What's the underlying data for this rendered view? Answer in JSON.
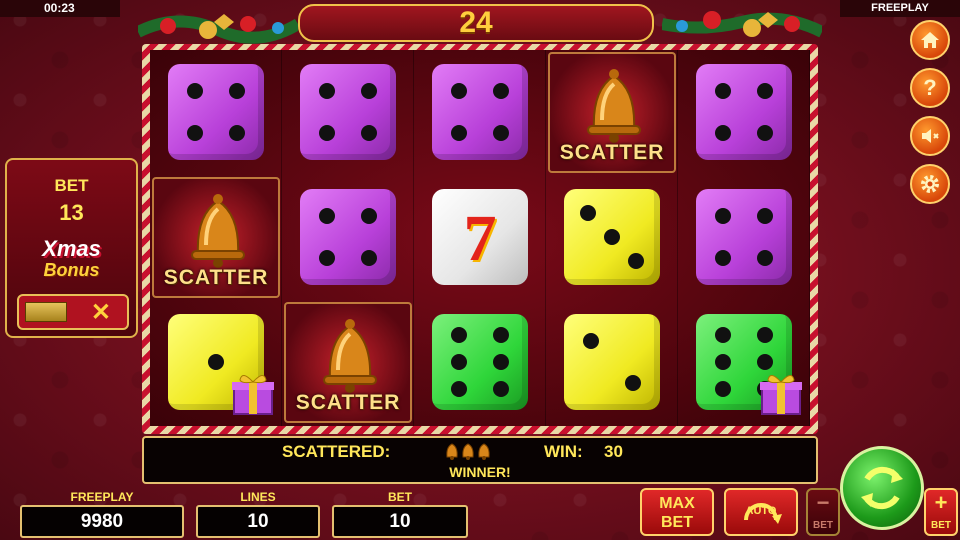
{
  "status": {
    "clock": "00:23",
    "mode": "FREEPLAY"
  },
  "header": {
    "counter": "24"
  },
  "reels": [
    [
      {
        "type": "die",
        "color": "purple",
        "pips": 4
      },
      {
        "type": "scatter",
        "label": "SCATTER"
      },
      {
        "type": "die",
        "color": "yellow",
        "pips": 1,
        "gift": true
      }
    ],
    [
      {
        "type": "die",
        "color": "purple",
        "pips": 4
      },
      {
        "type": "die",
        "color": "purple",
        "pips": 4
      },
      {
        "type": "scatter",
        "label": "SCATTER"
      }
    ],
    [
      {
        "type": "die",
        "color": "purple",
        "pips": 4
      },
      {
        "type": "seven",
        "symbol": "7"
      },
      {
        "type": "die",
        "color": "green",
        "pips": 6
      }
    ],
    [
      {
        "type": "scatter",
        "label": "SCATTER"
      },
      {
        "type": "die",
        "color": "yellow",
        "pips": 3
      },
      {
        "type": "die",
        "color": "yellow",
        "pips": 2
      }
    ],
    [
      {
        "type": "die",
        "color": "purple",
        "pips": 4
      },
      {
        "type": "die",
        "color": "purple",
        "pips": 4
      },
      {
        "type": "die",
        "color": "green",
        "pips": 6,
        "gift": true
      }
    ]
  ],
  "info": {
    "scattered_label": "SCATTERED:",
    "scatter_icons": 3,
    "win_label": "WIN:",
    "win_value": "30",
    "status": "WINNER!"
  },
  "bonus": {
    "bet_label": "BET",
    "bet_value": "13",
    "title_line1": "Xmas",
    "title_line2": "Bonus",
    "toggle_close": "✕"
  },
  "side_buttons": [
    {
      "name": "home-icon"
    },
    {
      "name": "help-icon",
      "glyph": "?"
    },
    {
      "name": "sound-muted-icon"
    },
    {
      "name": "gear-icon"
    }
  ],
  "bottom": {
    "freeplay_label": "FREEPLAY",
    "freeplay_value": "9980",
    "lines_label": "LINES",
    "lines_value": "10",
    "bet_label": "BET",
    "bet_value": "10",
    "max_bet_line1": "MAX",
    "max_bet_line2": "BET",
    "auto_label": "AUTO",
    "bet_minus_sign": "−",
    "bet_minus_caption": "BET",
    "bet_plus_sign": "+",
    "bet_plus_caption": "BET"
  },
  "colors": {
    "accent_gold": "#ffe75a",
    "background": "#7a0a18",
    "purple_die": "#c24ae0",
    "yellow_die": "#f0ea22",
    "green_die": "#2fd63a"
  }
}
